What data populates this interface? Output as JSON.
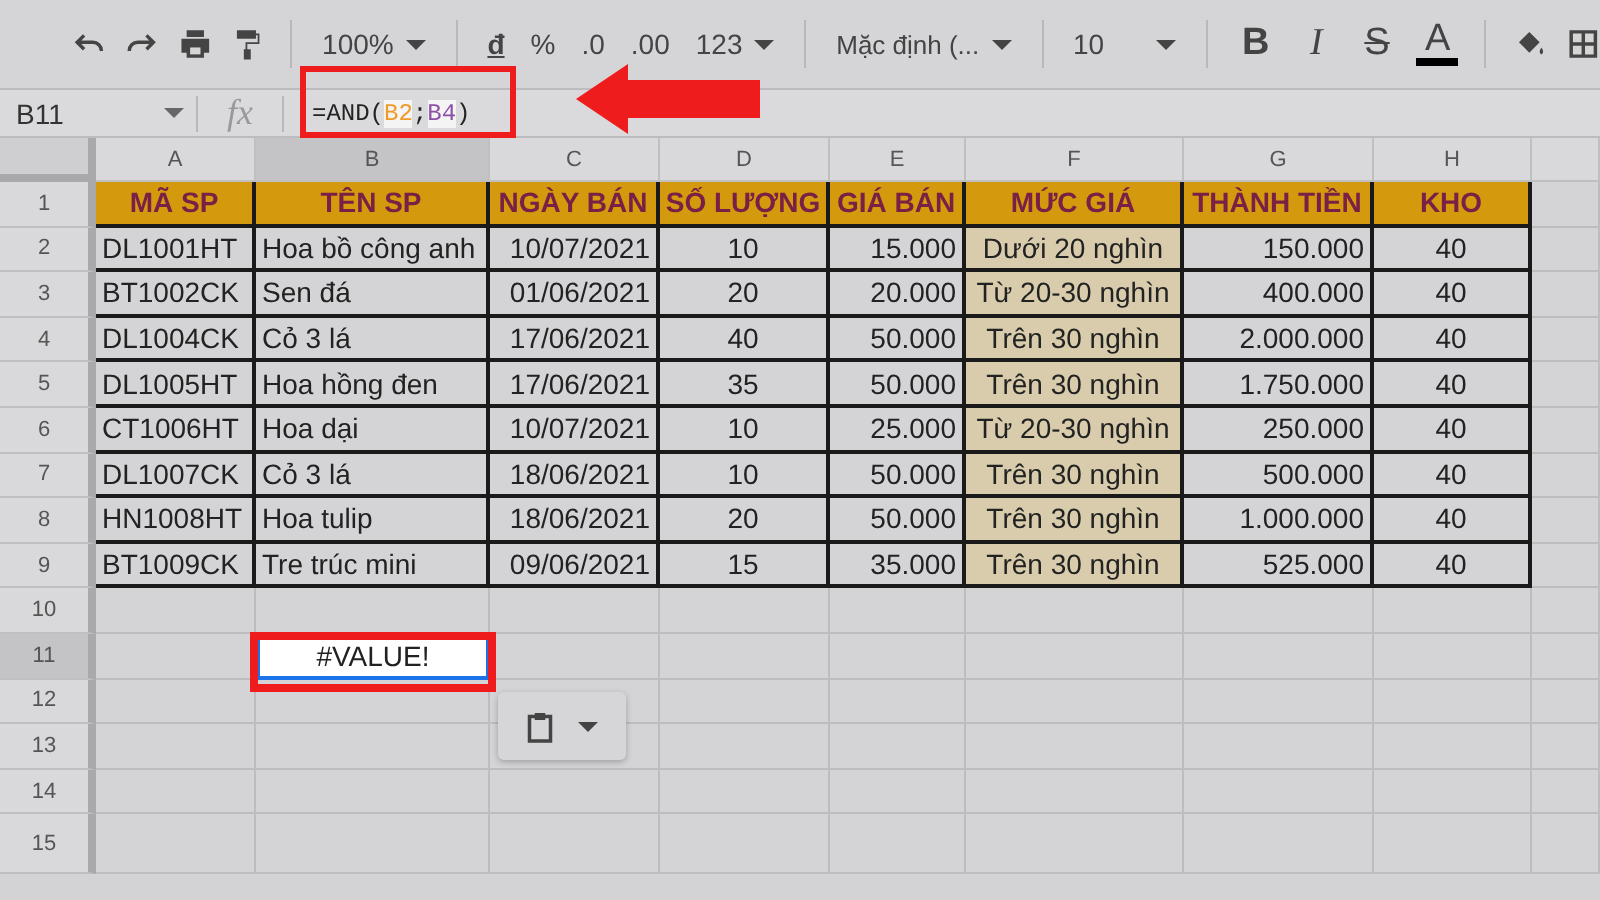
{
  "toolbar": {
    "zoom": "100%",
    "currency": "đ",
    "percent": "%",
    "decrease_decimals": ".0",
    "increase_decimals": ".00",
    "number_format": "123",
    "font": "Mặc định (...",
    "font_size": "10",
    "text_format": [
      "B",
      "I",
      "S",
      "A"
    ]
  },
  "formula_bar": {
    "cell_ref": "B11",
    "fx": "fx",
    "formula": [
      {
        "text": "=AND(",
        "kind": "plain"
      },
      {
        "text": "B2",
        "kind": "ref",
        "color": "#f09a27"
      },
      {
        "text": ";",
        "kind": "plain"
      },
      {
        "text": "B4",
        "kind": "ref",
        "color": "#8e4fa8"
      },
      {
        "text": ")",
        "kind": "plain"
      }
    ]
  },
  "columns": [
    {
      "letter": "A",
      "selected": false
    },
    {
      "letter": "B",
      "selected": true
    },
    {
      "letter": "C",
      "selected": false
    },
    {
      "letter": "D",
      "selected": false
    },
    {
      "letter": "E",
      "selected": false
    },
    {
      "letter": "F",
      "selected": false
    },
    {
      "letter": "G",
      "selected": false
    },
    {
      "letter": "H",
      "selected": false
    }
  ],
  "rows": [
    {
      "number": "1",
      "selected": false,
      "kind": "header",
      "cells": [
        "MÃ SP",
        "TÊN SP",
        "NGÀY BÁN",
        "SỐ LƯỢNG",
        "GIÁ BÁN",
        "MỨC GIÁ",
        "THÀNH TIỀN",
        "KHO"
      ]
    },
    {
      "number": "2",
      "selected": false,
      "kind": "data",
      "cells": [
        "DL1001HT",
        "Hoa bồ công anh",
        "10/07/2021",
        "10",
        "15.000",
        "Dưới 20 nghìn",
        "150.000",
        "40"
      ]
    },
    {
      "number": "3",
      "selected": false,
      "kind": "data",
      "cells": [
        "BT1002CK",
        "Sen đá",
        "01/06/2021",
        "20",
        "20.000",
        "Từ 20-30 nghìn",
        "400.000",
        "40"
      ]
    },
    {
      "number": "4",
      "selected": false,
      "kind": "data",
      "cells": [
        "DL1004CK",
        "Cỏ 3 lá",
        "17/06/2021",
        "40",
        "50.000",
        "Trên 30 nghìn",
        "2.000.000",
        "40"
      ]
    },
    {
      "number": "5",
      "selected": false,
      "kind": "data",
      "cells": [
        "DL1005HT",
        "Hoa hồng đen",
        "17/06/2021",
        "35",
        "50.000",
        "Trên 30 nghìn",
        "1.750.000",
        "40"
      ]
    },
    {
      "number": "6",
      "selected": false,
      "kind": "data",
      "cells": [
        "CT1006HT",
        "Hoa dại",
        "10/07/2021",
        "10",
        "25.000",
        "Từ 20-30 nghìn",
        "250.000",
        "40"
      ]
    },
    {
      "number": "7",
      "selected": false,
      "kind": "data",
      "cells": [
        "DL1007CK",
        "Cỏ 3 lá",
        "18/06/2021",
        "10",
        "50.000",
        "Trên 30 nghìn",
        "500.000",
        "40"
      ]
    },
    {
      "number": "8",
      "selected": false,
      "kind": "data",
      "cells": [
        "HN1008HT",
        "Hoa tulip",
        "18/06/2021",
        "20",
        "50.000",
        "Trên 30 nghìn",
        "1.000.000",
        "40"
      ]
    },
    {
      "number": "9",
      "selected": false,
      "kind": "data",
      "cells": [
        "BT1009CK",
        "Tre trúc mini",
        "09/06/2021",
        "15",
        "35.000",
        "Trên 30 nghìn",
        "525.000",
        "40"
      ]
    },
    {
      "number": "10",
      "selected": false,
      "kind": "empty"
    },
    {
      "number": "11",
      "selected": true,
      "kind": "empty",
      "active_cell": {
        "value": "#VALUE!"
      }
    },
    {
      "number": "12",
      "selected": false,
      "kind": "empty"
    },
    {
      "number": "13",
      "selected": false,
      "kind": "empty"
    },
    {
      "number": "14",
      "selected": false,
      "kind": "empty"
    },
    {
      "number": "15",
      "selected": false,
      "kind": "empty"
    }
  ]
}
